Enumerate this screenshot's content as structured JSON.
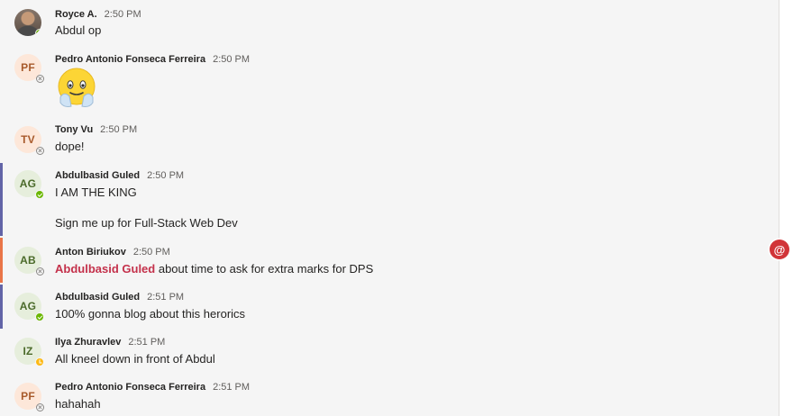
{
  "colors": {
    "available": "#6bb700",
    "away": "#fdb913",
    "mention": "#c4314b",
    "mark_purple": "#6264a7",
    "mark_orange": "#e97548"
  },
  "mention_badge": {
    "label": "@",
    "icon": "at-icon"
  },
  "messages": [
    {
      "author": "Royce A.",
      "time": "2:50 PM",
      "avatar": "",
      "presence": "available",
      "text": "Abdul op"
    },
    {
      "author": "Pedro Antonio Fonseca Ferreira",
      "time": "2:50 PM",
      "avatar": "PF",
      "presence": "offline",
      "emoji": "praying-emoji"
    },
    {
      "author": "Tony Vu",
      "time": "2:50 PM",
      "avatar": "TV",
      "presence": "offline",
      "text": "dope!"
    },
    {
      "author": "Abdulbasid Guled",
      "time": "2:50 PM",
      "avatar": "AG",
      "presence": "available",
      "text": "I AM THE KING",
      "text2": "Sign me up for Full-Stack Web Dev"
    },
    {
      "author": "Anton Biriukov",
      "time": "2:50 PM",
      "avatar": "AB",
      "presence": "offline",
      "mention": "Abdulbasid Guled",
      "text": " about time to ask for extra marks for DPS"
    },
    {
      "author": "Abdulbasid Guled",
      "time": "2:51 PM",
      "avatar": "AG",
      "presence": "available",
      "text": "100% gonna blog about this herorics"
    },
    {
      "author": "Ilya Zhuravlev",
      "time": "2:51 PM",
      "avatar": "IZ",
      "presence": "away",
      "text": "All kneel down in front of Abdul"
    },
    {
      "author": "Pedro Antonio Fonseca Ferreira",
      "time": "2:51 PM",
      "avatar": "PF",
      "presence": "offline",
      "text": "hahahah"
    }
  ]
}
